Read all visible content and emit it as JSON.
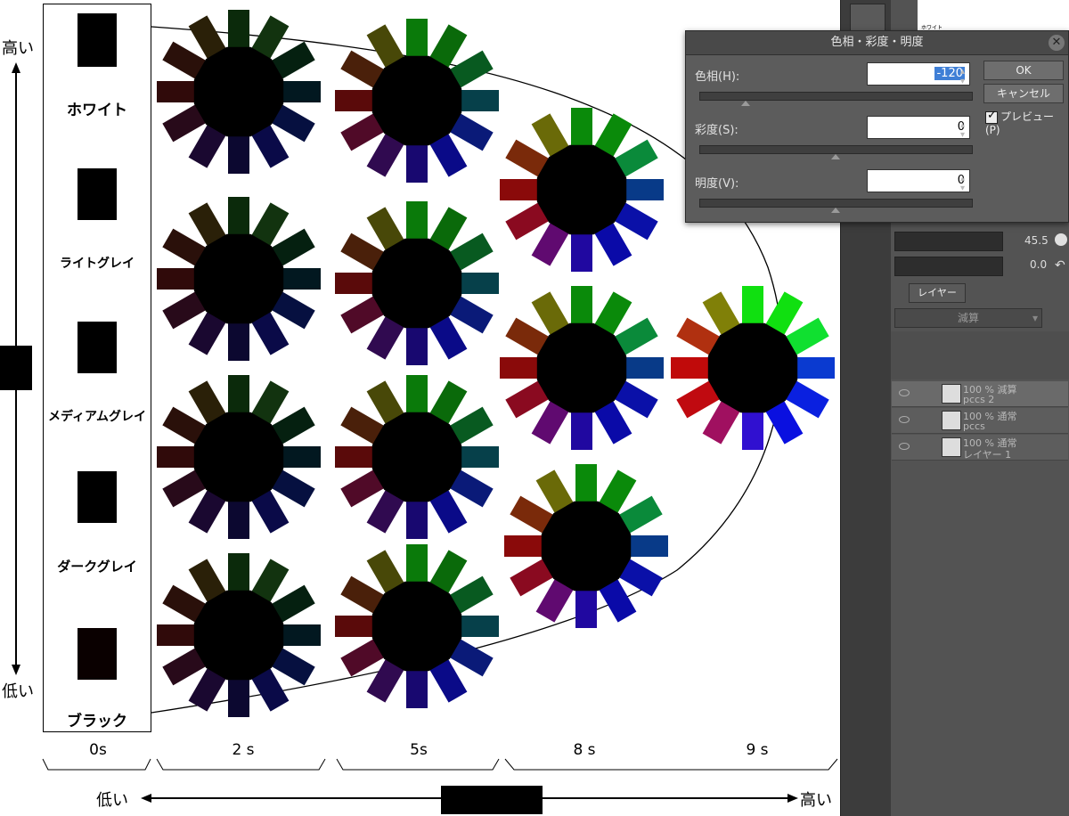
{
  "left_axis": {
    "top_label": "高い",
    "bottom_label": "低い"
  },
  "bottom_axis": {
    "left_label": "低い",
    "right_label": "高い"
  },
  "gray_column": {
    "items": [
      {
        "label": "ホワイト",
        "color": "#000000"
      },
      {
        "label": "ライトグレイ",
        "color": "#000000"
      },
      {
        "label": "メディアムグレイ",
        "color": "#000000"
      },
      {
        "label": "ダークグレイ",
        "color": "#000000"
      },
      {
        "label": "ブラック",
        "color": "#0a0000"
      }
    ]
  },
  "saturation_labels": [
    "0s",
    "2 s",
    "5s",
    "8 s",
    "9 s"
  ],
  "dialog": {
    "title": "色相・彩度・明度",
    "hue_label": "色相(H):",
    "hue_value": "-120",
    "hue_level": 0.17,
    "saturation_label": "彩度(S):",
    "saturation_value": "0",
    "saturation_level": 0.5,
    "brightness_label": "明度(V):",
    "brightness_value": "0",
    "brightness_level": 0.5,
    "ok_label": "OK",
    "cancel_label": "キャンセル",
    "preview_label": "プレビュー(P)",
    "preview_checked": true
  },
  "side_panel": {
    "value_1": "45.5",
    "value_2": "0.0",
    "layer_tab": "レイヤー",
    "blend_mode": "減算",
    "thumb_label": "ホワイト",
    "layers": [
      {
        "line1": "100 % 減算",
        "line2": "pccs 2"
      },
      {
        "line1": "100 % 通常",
        "line2": "pccs"
      },
      {
        "line1": "100 % 通常",
        "line2": "レイヤー 1"
      }
    ]
  },
  "wheel_palettes": {
    "2s": [
      "#0b2a0b",
      "#12330f",
      "#052010",
      "#021820",
      "#061040",
      "#0a0a48",
      "#0c0830",
      "#1a0830",
      "#280a1a",
      "#300a0a",
      "#2a100a",
      "#2a2008"
    ],
    "5s": [
      "#0a7a0a",
      "#0a6a0a",
      "#085a20",
      "#06404a",
      "#0a1a78",
      "#0a0a88",
      "#180870",
      "#300a50",
      "#500a28",
      "#5a0a0a",
      "#4a200a",
      "#484808"
    ],
    "8s": [
      "#0a8a0a",
      "#0a8a0a",
      "#0a8a3a",
      "#083a88",
      "#0a10a8",
      "#0a0aa8",
      "#2008a0",
      "#600a70",
      "#8a0a20",
      "#8a0a0a",
      "#7a2a0a",
      "#6a6a08"
    ],
    "9s": [
      "#10e010",
      "#10e010",
      "#10e030",
      "#0a3ad0",
      "#0a20e0",
      "#0a10e0",
      "#3010d0",
      "#a01060",
      "#c00a10",
      "#c00a0a",
      "#b03010",
      "#808008"
    ]
  }
}
